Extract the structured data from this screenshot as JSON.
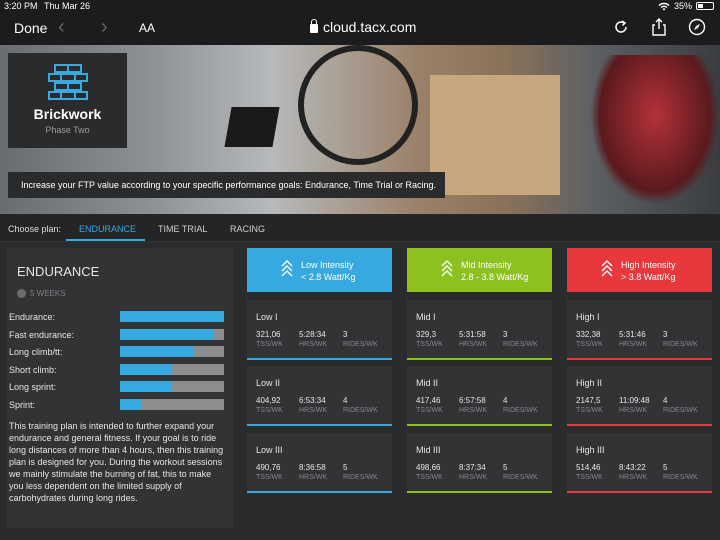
{
  "status": {
    "time": "3:20 PM",
    "date": "Thu Mar 26",
    "battery": "35%"
  },
  "browser": {
    "done": "Done",
    "back_icon": "chevron-left-icon",
    "forward_icon": "chevron-right-icon",
    "text_size": "AA",
    "url": "cloud.tacx.com"
  },
  "hero": {
    "plan_name": "Brickwork",
    "phase": "Phase Two",
    "banner": "Increase your FTP value according to your specific performance goals: Endurance, Time Trial or Racing."
  },
  "plan_tabs": {
    "label": "Choose plan:",
    "tabs": [
      "ENDURANCE",
      "TIME TRIAL",
      "RACING"
    ],
    "active": "ENDURANCE"
  },
  "plan": {
    "title": "ENDURANCE",
    "weeks": "5 WEEKS",
    "metrics": [
      {
        "label": "Endurance:",
        "level": 1.0
      },
      {
        "label": "Fast endurance:",
        "level": 0.9
      },
      {
        "label": "Long climb/tt:",
        "level": 0.7
      },
      {
        "label": "Short climb:",
        "level": 0.5
      },
      {
        "label": "Long sprint:",
        "level": 0.5
      },
      {
        "label": "Sprint:",
        "level": 0.2
      }
    ],
    "description": "This training plan is intended to further expand your endurance and general fitness. If your goal is to ride long distances of more than 4 hours, then this training plan is designed for you. During the workout sessions we mainly stimulate the burning of fat, this to make you less dependent on the limited supply of carbohydrates during long rides."
  },
  "intensity": [
    {
      "name": "Low Intensity",
      "range": "< 2.8 Watt/Kg",
      "color": "#36a9e1",
      "workouts": [
        {
          "name": "Low I",
          "tss": "321,06",
          "hrs": "5:28:34",
          "rides": "3"
        },
        {
          "name": "Low II",
          "tss": "404,92",
          "hrs": "6:53:34",
          "rides": "4"
        },
        {
          "name": "Low III",
          "tss": "490,76",
          "hrs": "8:36:58",
          "rides": "5"
        }
      ]
    },
    {
      "name": "Mid Intensity",
      "range": "2.8 - 3.8 Watt/Kg",
      "color": "#8cc11f",
      "workouts": [
        {
          "name": "Mid I",
          "tss": "329,3",
          "hrs": "5:31:58",
          "rides": "3"
        },
        {
          "name": "Mid II",
          "tss": "417,46",
          "hrs": "6:57:58",
          "rides": "4"
        },
        {
          "name": "Mid III",
          "tss": "498,66",
          "hrs": "8:37:34",
          "rides": "5"
        }
      ]
    },
    {
      "name": "High Intensity",
      "range": "> 3.8 Watt/Kg",
      "color": "#e8383d",
      "workouts": [
        {
          "name": "High I",
          "tss": "332,38",
          "hrs": "5:31:46",
          "rides": "3"
        },
        {
          "name": "High II",
          "tss": "2147,5",
          "hrs": "11:09:48",
          "rides": "4"
        },
        {
          "name": "High III",
          "tss": "514,46",
          "hrs": "8:43:22",
          "rides": "5"
        }
      ]
    }
  ],
  "units": {
    "tss": "TSS/WK",
    "hrs": "HRS/WK",
    "rides": "RIDES/WK"
  }
}
